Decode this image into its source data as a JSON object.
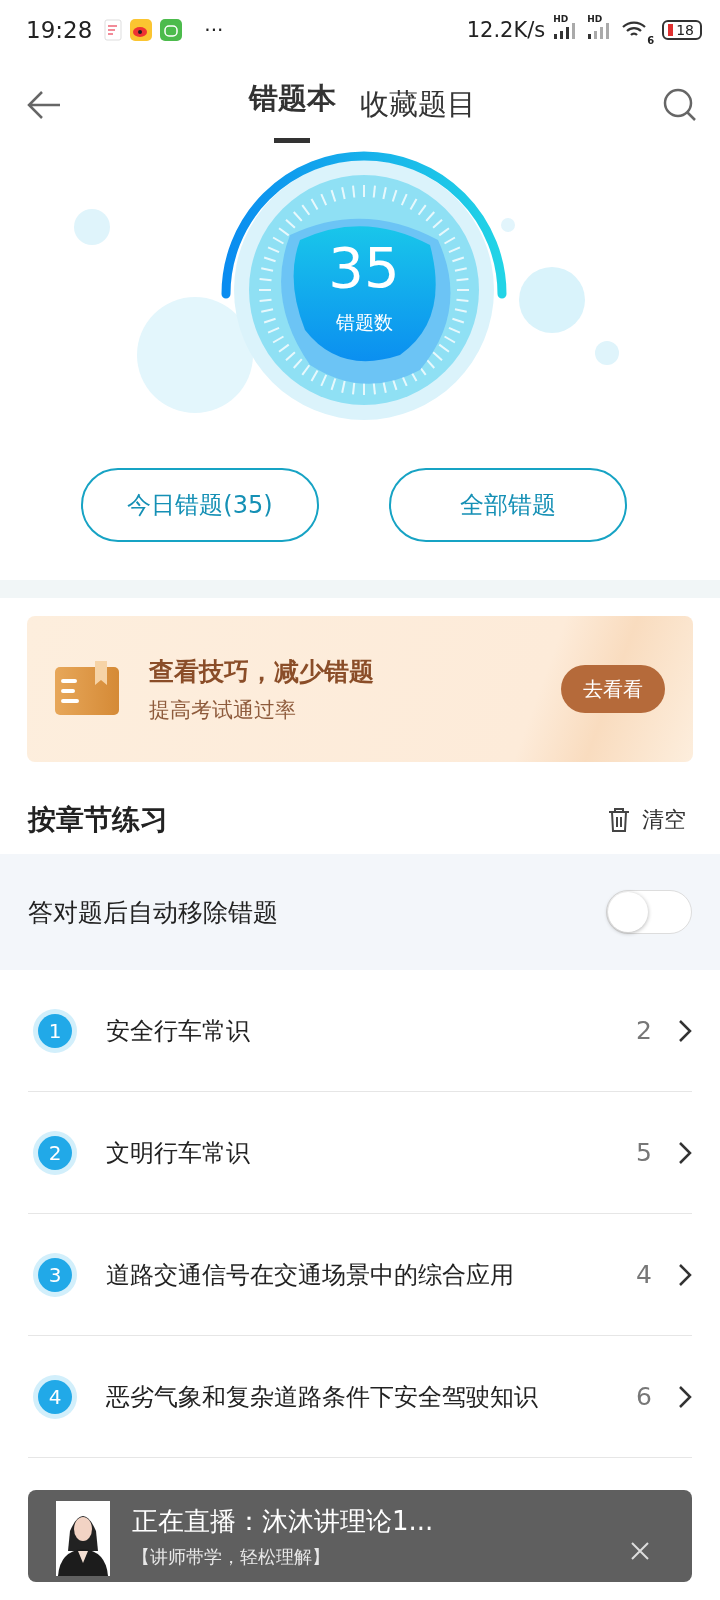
{
  "status_bar": {
    "time": "19:28",
    "more": "···",
    "speed": "12.2K/s",
    "hd_1": "HD",
    "hd_2": "HD",
    "wifi_number": "6",
    "battery": "18"
  },
  "tabs": [
    {
      "label": "错题本",
      "selected": true
    },
    {
      "label": "收藏题目",
      "selected": false
    }
  ],
  "gauge": {
    "count": "35",
    "label": "错题数"
  },
  "buttons": [
    "今日错题(35)",
    "全部错题"
  ],
  "banner": {
    "title": "查看技巧，减少错题",
    "subtitle": "提高考试通过率",
    "button": "去看看"
  },
  "section": {
    "title": "按章节练习",
    "clear": "清空"
  },
  "auto_remove": {
    "label": "答对题后自动移除错题",
    "on": false
  },
  "chapters": [
    {
      "index": "1",
      "title": "安全行车常识",
      "count": "2"
    },
    {
      "index": "2",
      "title": "文明行车常识",
      "count": "5"
    },
    {
      "index": "3",
      "title": "道路交通信号在交通场景中的综合应用",
      "count": "4"
    },
    {
      "index": "4",
      "title": "恶劣气象和复杂道路条件下安全驾驶知识",
      "count": "6"
    }
  ],
  "live_popup": {
    "title": "正在直播：沐沐讲理论1...",
    "subtitle": "【讲师带学，轻松理解】"
  }
}
